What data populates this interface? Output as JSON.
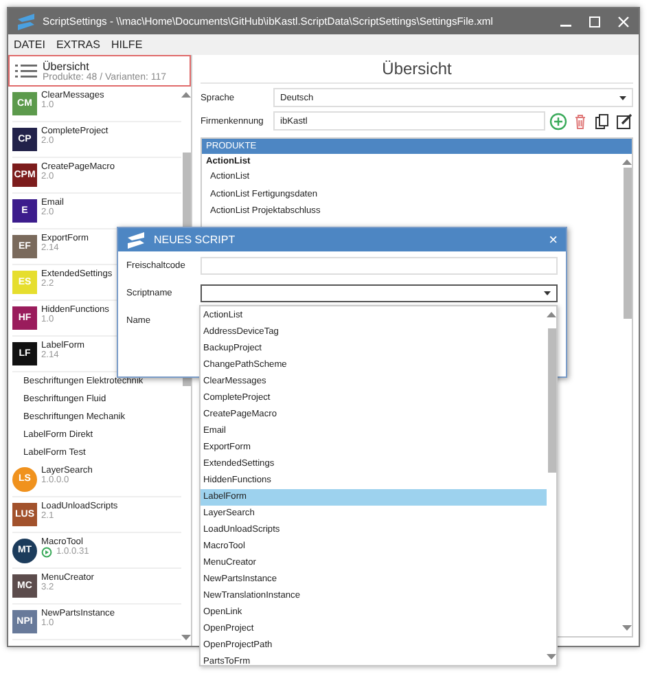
{
  "window": {
    "title": "ScriptSettings - \\\\mac\\Home\\Documents\\GitHub\\ibKastl.ScriptData\\ScriptSettings\\SettingsFile.xml"
  },
  "menu": [
    "DATEI",
    "EXTRAS",
    "HILFE"
  ],
  "sidebar": {
    "overview": {
      "title": "Übersicht",
      "subtitle": "Produkte: 48 / Varianten: 117",
      "selected": true
    },
    "items": [
      {
        "badge": "CM",
        "name": "ClearMessages",
        "version": "1.0",
        "color": "#5c9a4c",
        "kind": "square",
        "synced": false
      },
      {
        "badge": "CP",
        "name": "CompleteProject",
        "version": "2.0",
        "color": "#22224a",
        "kind": "square",
        "synced": false
      },
      {
        "badge": "CPM",
        "name": "CreatePageMacro",
        "version": "2.0",
        "color": "#7c1c1c",
        "kind": "square",
        "synced": false
      },
      {
        "badge": "E",
        "name": "Email",
        "version": "2.0",
        "color": "#3c1c8c",
        "kind": "square",
        "synced": false
      },
      {
        "badge": "EF",
        "name": "ExportForm",
        "version": "2.14",
        "color": "#7a6a5c",
        "kind": "square",
        "synced": false
      },
      {
        "badge": "ES",
        "name": "ExtendedSettings",
        "version": "2.2",
        "color": "#e6de2e",
        "kind": "square",
        "synced": false
      },
      {
        "badge": "HF",
        "name": "HiddenFunctions",
        "version": "1.0",
        "color": "#9a1c5c",
        "kind": "square",
        "synced": false
      },
      {
        "badge": "LF",
        "name": "LabelForm",
        "version": "2.14",
        "color": "#111111",
        "kind": "square",
        "synced": false,
        "children": [
          {
            "name": "Beschriftungen Elektrotechnik"
          },
          {
            "name": "Beschriftungen Fluid"
          },
          {
            "name": "Beschriftungen Mechanik"
          },
          {
            "name": "LabelForm Direkt"
          },
          {
            "name": "LabelForm Test"
          }
        ]
      },
      {
        "badge": "LS",
        "name": "LayerSearch",
        "version": "1.0.0.0",
        "color": "#f0921e",
        "kind": "circle",
        "synced": false
      },
      {
        "badge": "LUS",
        "name": "LoadUnloadScripts",
        "version": "2.1",
        "color": "#a2522c",
        "kind": "square",
        "synced": false
      },
      {
        "badge": "MT",
        "name": "MacroTool",
        "version": "1.0.0.31",
        "color": "#1c3c5c",
        "kind": "circle",
        "synced": true
      },
      {
        "badge": "MC",
        "name": "MenuCreator",
        "version": "3.2",
        "color": "#5c4c4c",
        "kind": "square",
        "synced": false
      },
      {
        "badge": "NPI",
        "name": "NewPartsInstance",
        "version": "1.0",
        "color": "#687a9a",
        "kind": "square",
        "synced": false
      }
    ]
  },
  "overview": {
    "heading": "Übersicht",
    "language_label": "Sprache",
    "language": "Deutsch",
    "company_label": "Firmenkennung",
    "company": "ibKastl",
    "products": {
      "header": "PRODUKTE",
      "groups": [
        {
          "name": "ActionList",
          "children": [
            {
              "name": "ActionList"
            },
            {
              "name": "ActionList Fertigungsdaten"
            },
            {
              "name": "ActionList Projektabschluss"
            }
          ]
        }
      ]
    }
  },
  "dialog": {
    "title": "NEUES SCRIPT",
    "close": "×",
    "code_label": "Freischaltcode",
    "script_label": "Scriptname",
    "name_label": "Name",
    "options": [
      {
        "label": "ActionList",
        "selected": false
      },
      {
        "label": "AddressDeviceTag",
        "selected": false
      },
      {
        "label": "BackupProject",
        "selected": false
      },
      {
        "label": "ChangePathScheme",
        "selected": false
      },
      {
        "label": "ClearMessages",
        "selected": false
      },
      {
        "label": "CompleteProject",
        "selected": false
      },
      {
        "label": "CreatePageMacro",
        "selected": false
      },
      {
        "label": "Email",
        "selected": false
      },
      {
        "label": "ExportForm",
        "selected": false
      },
      {
        "label": "ExtendedSettings",
        "selected": false
      },
      {
        "label": "HiddenFunctions",
        "selected": false
      },
      {
        "label": "LabelForm",
        "selected": true
      },
      {
        "label": "LayerSearch",
        "selected": false
      },
      {
        "label": "LoadUnloadScripts",
        "selected": false
      },
      {
        "label": "MacroTool",
        "selected": false
      },
      {
        "label": "MenuCreator",
        "selected": false
      },
      {
        "label": "NewPartsInstance",
        "selected": false
      },
      {
        "label": "NewTranslationInstance",
        "selected": false
      },
      {
        "label": "OpenLink",
        "selected": false
      },
      {
        "label": "OpenProject",
        "selected": false
      },
      {
        "label": "OpenProjectPath",
        "selected": false
      },
      {
        "label": "PartsToFrm",
        "selected": false
      }
    ]
  }
}
